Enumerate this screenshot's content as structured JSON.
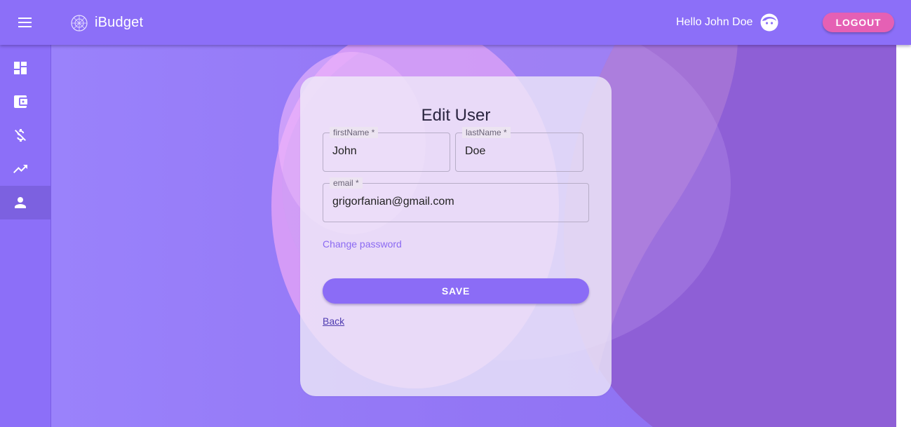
{
  "app": {
    "title": "iBudget",
    "greeting": "Hello John Doe",
    "logout_label": "LOGOUT"
  },
  "sidebar": {
    "items": [
      {
        "name": "dashboard",
        "icon": "dashboard-icon"
      },
      {
        "name": "wallet",
        "icon": "wallet-icon"
      },
      {
        "name": "expenses",
        "icon": "money-off-icon"
      },
      {
        "name": "trends",
        "icon": "trending-up-icon"
      },
      {
        "name": "profile",
        "icon": "person-icon",
        "active": true
      }
    ]
  },
  "form": {
    "title": "Edit User",
    "first_name": {
      "label": "firstName *",
      "value": "John"
    },
    "last_name": {
      "label": "lastName *",
      "value": "Doe"
    },
    "email": {
      "label": "email *",
      "value": "grigorfanian@gmail.com"
    },
    "change_password_label": "Change password",
    "save_label": "SAVE",
    "back_label": "Back"
  },
  "colors": {
    "primary": "#8c6ff8",
    "accent": "#e560b4",
    "link": "#8b6af2"
  }
}
